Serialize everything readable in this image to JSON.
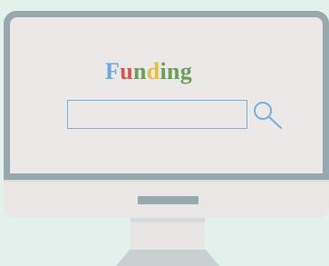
{
  "logo": {
    "letters": [
      {
        "char": "F",
        "color": "#6aa9e0"
      },
      {
        "char": "u",
        "color": "#d9534f"
      },
      {
        "char": "n",
        "color": "#6b9e57"
      },
      {
        "char": "d",
        "color": "#e8bf3c"
      },
      {
        "char": "i",
        "color": "#6b9e57"
      },
      {
        "char": "n",
        "color": "#6b9e57"
      },
      {
        "char": "g",
        "color": "#6b9e57"
      }
    ]
  },
  "search": {
    "value": "",
    "placeholder": "",
    "icon": "search-icon"
  },
  "colors": {
    "background": "#e3f1ed",
    "bezel": "#97a9ae",
    "screen": "#ebe8e7",
    "search_border": "#78b0df"
  }
}
